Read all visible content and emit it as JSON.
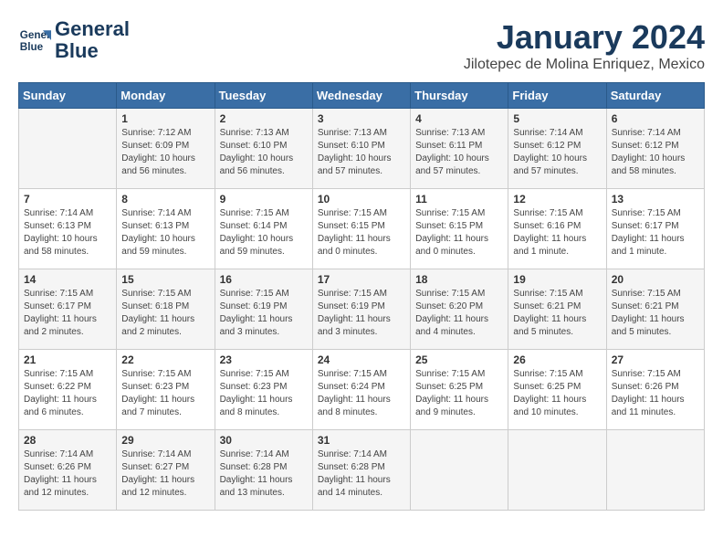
{
  "logo": {
    "line1": "General",
    "line2": "Blue"
  },
  "title": "January 2024",
  "location": "Jilotepec de Molina Enriquez, Mexico",
  "days_of_week": [
    "Sunday",
    "Monday",
    "Tuesday",
    "Wednesday",
    "Thursday",
    "Friday",
    "Saturday"
  ],
  "weeks": [
    [
      {
        "day": "",
        "content": ""
      },
      {
        "day": "1",
        "content": "Sunrise: 7:12 AM\nSunset: 6:09 PM\nDaylight: 10 hours\nand 56 minutes."
      },
      {
        "day": "2",
        "content": "Sunrise: 7:13 AM\nSunset: 6:10 PM\nDaylight: 10 hours\nand 56 minutes."
      },
      {
        "day": "3",
        "content": "Sunrise: 7:13 AM\nSunset: 6:10 PM\nDaylight: 10 hours\nand 57 minutes."
      },
      {
        "day": "4",
        "content": "Sunrise: 7:13 AM\nSunset: 6:11 PM\nDaylight: 10 hours\nand 57 minutes."
      },
      {
        "day": "5",
        "content": "Sunrise: 7:14 AM\nSunset: 6:12 PM\nDaylight: 10 hours\nand 57 minutes."
      },
      {
        "day": "6",
        "content": "Sunrise: 7:14 AM\nSunset: 6:12 PM\nDaylight: 10 hours\nand 58 minutes."
      }
    ],
    [
      {
        "day": "7",
        "content": "Sunrise: 7:14 AM\nSunset: 6:13 PM\nDaylight: 10 hours\nand 58 minutes."
      },
      {
        "day": "8",
        "content": "Sunrise: 7:14 AM\nSunset: 6:13 PM\nDaylight: 10 hours\nand 59 minutes."
      },
      {
        "day": "9",
        "content": "Sunrise: 7:15 AM\nSunset: 6:14 PM\nDaylight: 10 hours\nand 59 minutes."
      },
      {
        "day": "10",
        "content": "Sunrise: 7:15 AM\nSunset: 6:15 PM\nDaylight: 11 hours\nand 0 minutes."
      },
      {
        "day": "11",
        "content": "Sunrise: 7:15 AM\nSunset: 6:15 PM\nDaylight: 11 hours\nand 0 minutes."
      },
      {
        "day": "12",
        "content": "Sunrise: 7:15 AM\nSunset: 6:16 PM\nDaylight: 11 hours\nand 1 minute."
      },
      {
        "day": "13",
        "content": "Sunrise: 7:15 AM\nSunset: 6:17 PM\nDaylight: 11 hours\nand 1 minute."
      }
    ],
    [
      {
        "day": "14",
        "content": "Sunrise: 7:15 AM\nSunset: 6:17 PM\nDaylight: 11 hours\nand 2 minutes."
      },
      {
        "day": "15",
        "content": "Sunrise: 7:15 AM\nSunset: 6:18 PM\nDaylight: 11 hours\nand 2 minutes."
      },
      {
        "day": "16",
        "content": "Sunrise: 7:15 AM\nSunset: 6:19 PM\nDaylight: 11 hours\nand 3 minutes."
      },
      {
        "day": "17",
        "content": "Sunrise: 7:15 AM\nSunset: 6:19 PM\nDaylight: 11 hours\nand 3 minutes."
      },
      {
        "day": "18",
        "content": "Sunrise: 7:15 AM\nSunset: 6:20 PM\nDaylight: 11 hours\nand 4 minutes."
      },
      {
        "day": "19",
        "content": "Sunrise: 7:15 AM\nSunset: 6:21 PM\nDaylight: 11 hours\nand 5 minutes."
      },
      {
        "day": "20",
        "content": "Sunrise: 7:15 AM\nSunset: 6:21 PM\nDaylight: 11 hours\nand 5 minutes."
      }
    ],
    [
      {
        "day": "21",
        "content": "Sunrise: 7:15 AM\nSunset: 6:22 PM\nDaylight: 11 hours\nand 6 minutes."
      },
      {
        "day": "22",
        "content": "Sunrise: 7:15 AM\nSunset: 6:23 PM\nDaylight: 11 hours\nand 7 minutes."
      },
      {
        "day": "23",
        "content": "Sunrise: 7:15 AM\nSunset: 6:23 PM\nDaylight: 11 hours\nand 8 minutes."
      },
      {
        "day": "24",
        "content": "Sunrise: 7:15 AM\nSunset: 6:24 PM\nDaylight: 11 hours\nand 8 minutes."
      },
      {
        "day": "25",
        "content": "Sunrise: 7:15 AM\nSunset: 6:25 PM\nDaylight: 11 hours\nand 9 minutes."
      },
      {
        "day": "26",
        "content": "Sunrise: 7:15 AM\nSunset: 6:25 PM\nDaylight: 11 hours\nand 10 minutes."
      },
      {
        "day": "27",
        "content": "Sunrise: 7:15 AM\nSunset: 6:26 PM\nDaylight: 11 hours\nand 11 minutes."
      }
    ],
    [
      {
        "day": "28",
        "content": "Sunrise: 7:14 AM\nSunset: 6:26 PM\nDaylight: 11 hours\nand 12 minutes."
      },
      {
        "day": "29",
        "content": "Sunrise: 7:14 AM\nSunset: 6:27 PM\nDaylight: 11 hours\nand 12 minutes."
      },
      {
        "day": "30",
        "content": "Sunrise: 7:14 AM\nSunset: 6:28 PM\nDaylight: 11 hours\nand 13 minutes."
      },
      {
        "day": "31",
        "content": "Sunrise: 7:14 AM\nSunset: 6:28 PM\nDaylight: 11 hours\nand 14 minutes."
      },
      {
        "day": "",
        "content": ""
      },
      {
        "day": "",
        "content": ""
      },
      {
        "day": "",
        "content": ""
      }
    ]
  ]
}
